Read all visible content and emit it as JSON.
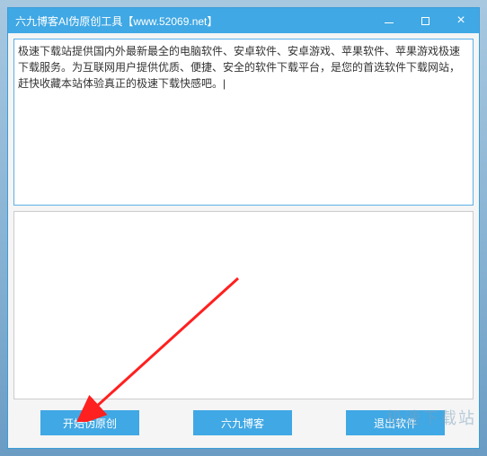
{
  "titlebar": {
    "title": "六九博客AI伪原创工具【www.52069.net】"
  },
  "input": {
    "text": "极速下载站提供国内外最新最全的电脑软件、安卓软件、安卓游戏、苹果软件、苹果游戏极速下载服务。为互联网用户提供优质、便捷、安全的软件下载平台，是您的首选软件下载网站，赶快收藏本站体验真正的极速下载快感吧。|"
  },
  "output": {
    "text": ""
  },
  "buttons": {
    "start": "开始伪原创",
    "blog": "六九博客",
    "exit": "退出软件"
  },
  "watermark": "极速下载站"
}
